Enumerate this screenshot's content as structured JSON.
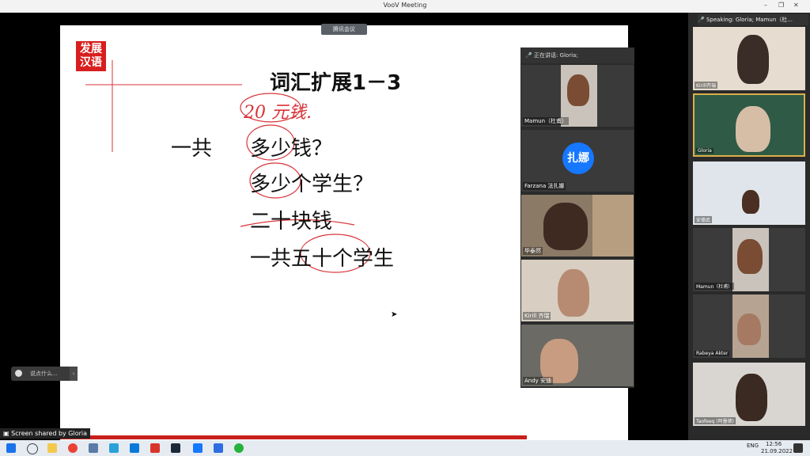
{
  "window": {
    "title": "VooV Meeting",
    "min_glyph": "–",
    "max_glyph": "❐",
    "close_glyph": "✕"
  },
  "slide": {
    "logo_line1": "发展",
    "logo_line2": "汉语",
    "title": "词汇扩展1－3",
    "annotation": "20 元钱.",
    "words": {
      "yigong": "一共",
      "duoshao_qian": "多少钱？",
      "duoshao_xuesheng": "多少个学生？",
      "ershi_kuai": "二十块钱",
      "yigong_wushi": "一共五十个学生"
    }
  },
  "meeting_badge": "腾讯会议",
  "chat_placeholder": "说点什么...",
  "speaking_panel": {
    "header": "正在讲话: Gloria;",
    "tiles": [
      {
        "name": "Mamun（杜甫）"
      },
      {
        "name": "Farzana 法扎娜",
        "avatar_text": "扎娜"
      },
      {
        "name": "毕泰然"
      },
      {
        "name": "Kirill 齐瑞"
      },
      {
        "name": "Andy 安迪"
      }
    ]
  },
  "right_panel": {
    "header": "Speaking: Gloria; Mamun（杜...",
    "tiles": [
      {
        "name": "Kirill齐瑞"
      },
      {
        "name": "Gloria"
      },
      {
        "name": "安德武"
      },
      {
        "name": "Mamun（杜甫）"
      },
      {
        "name": "Rabeya Akter"
      },
      {
        "name": "Taofeeq (阿墨德)"
      }
    ]
  },
  "share_bar": "Screen shared by Gloria",
  "taskbar": {
    "lang": "ENG",
    "time": "12:56",
    "date": "21.09.2022"
  },
  "colors": {
    "accent": "#d81e1e",
    "ink": "#d9343a",
    "zhana_avatar": "#1677ff"
  }
}
